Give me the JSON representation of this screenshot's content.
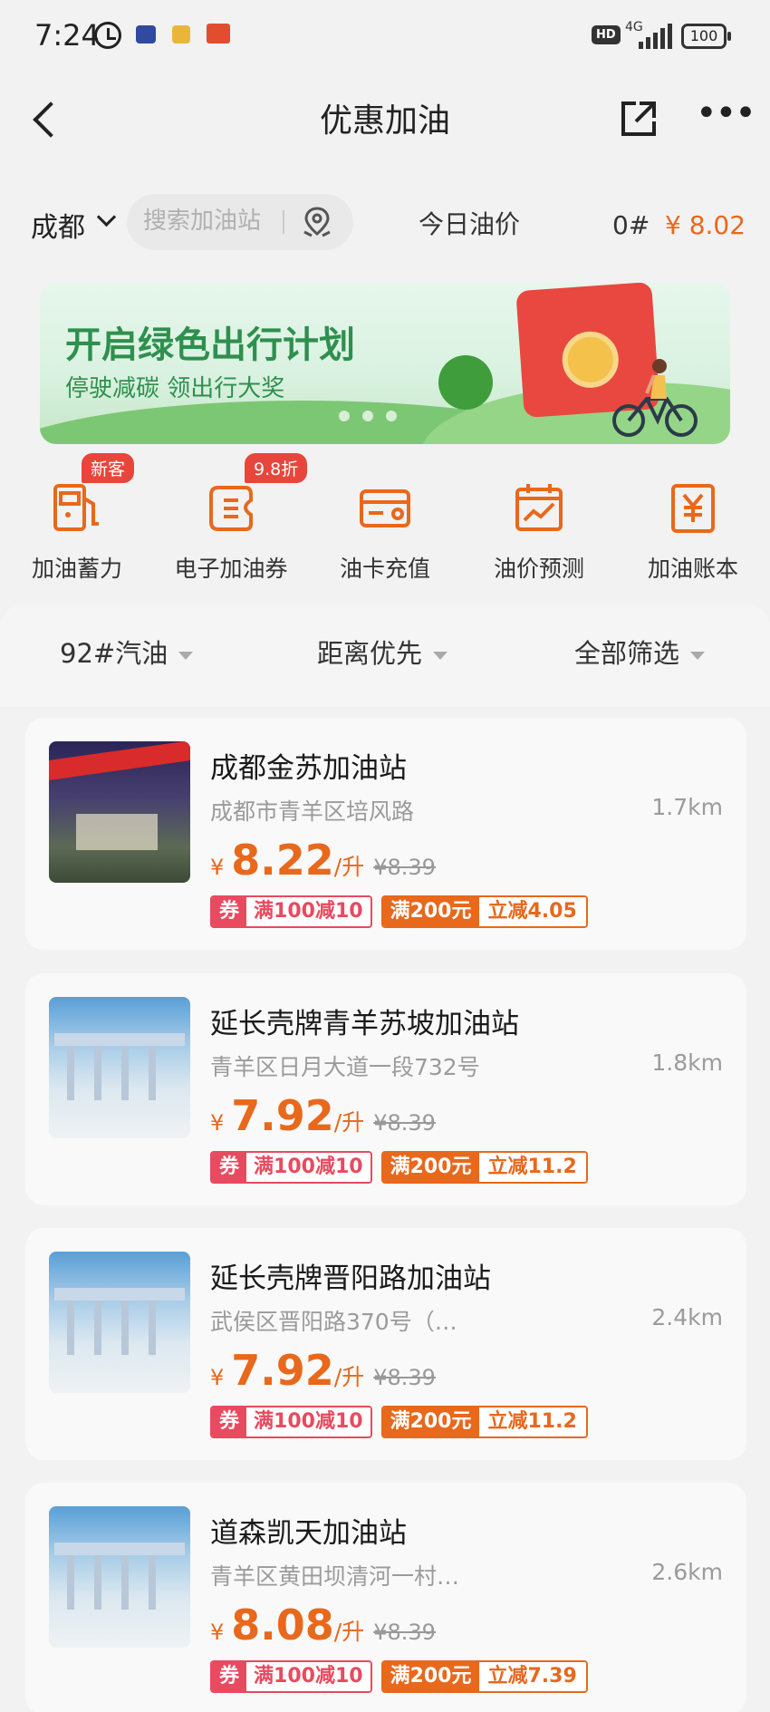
{
  "status_bar": {
    "time": "7:24",
    "network": "4G",
    "battery": "100",
    "hd": "HD"
  },
  "header": {
    "title": "优惠加油"
  },
  "search_bar": {
    "city": "成都",
    "search_placeholder": "搜索加油站",
    "today_price_label": "今日油价",
    "oil_grade": "0#",
    "oil_price": "¥ 8.02"
  },
  "banner": {
    "title": "开启绿色出行计划",
    "subtitle": "停驶减碳  领出行大奖"
  },
  "quick_entries": [
    {
      "label": "加油蓄力",
      "badge": "新客",
      "icon": "fuel-pump-icon"
    },
    {
      "label": "电子加油券",
      "badge": "9.8折",
      "icon": "coupon-icon"
    },
    {
      "label": "油卡充值",
      "badge": "",
      "icon": "card-icon"
    },
    {
      "label": "油价预测",
      "badge": "",
      "icon": "chart-calendar-icon"
    },
    {
      "label": "加油账本",
      "badge": "",
      "icon": "yen-ledger-icon"
    }
  ],
  "filters": {
    "fuel_type": "92#汽油",
    "sort": "距离优先",
    "filter": "全部筛选"
  },
  "stations": [
    {
      "name": "成都金苏加油站",
      "address": "成都市青羊区培风路",
      "distance": "1.7km",
      "currency": "¥",
      "price": "8.22",
      "unit": "/升",
      "original_price": "¥8.39",
      "coupon_label": "券",
      "coupon_text": "满100减10",
      "promo_label": "满200元",
      "promo_text": "立减4.05"
    },
    {
      "name": "延长壳牌青羊苏坡加油站",
      "address": "青羊区日月大道一段732号",
      "distance": "1.8km",
      "currency": "¥",
      "price": "7.92",
      "unit": "/升",
      "original_price": "¥8.39",
      "coupon_label": "券",
      "coupon_text": "满100减10",
      "promo_label": "满200元",
      "promo_text": "立减11.2"
    },
    {
      "name": "延长壳牌晋阳路加油站",
      "address": "武侯区晋阳路370号（…",
      "distance": "2.4km",
      "currency": "¥",
      "price": "7.92",
      "unit": "/升",
      "original_price": "¥8.39",
      "coupon_label": "券",
      "coupon_text": "满100减10",
      "promo_label": "满200元",
      "promo_text": "立减11.2"
    },
    {
      "name": "道森凯天加油站",
      "address": "青羊区黄田坝清河一村…",
      "distance": "2.6km",
      "currency": "¥",
      "price": "8.08",
      "unit": "/升",
      "original_price": "¥8.39",
      "coupon_label": "券",
      "coupon_text": "满100减10",
      "promo_label": "满200元",
      "promo_text": "立减7.39"
    }
  ],
  "colors": {
    "accent": "#e8681c",
    "coupon": "#e84a5f",
    "badge": "#e8453c",
    "banner_green": "#2f8f4e"
  }
}
